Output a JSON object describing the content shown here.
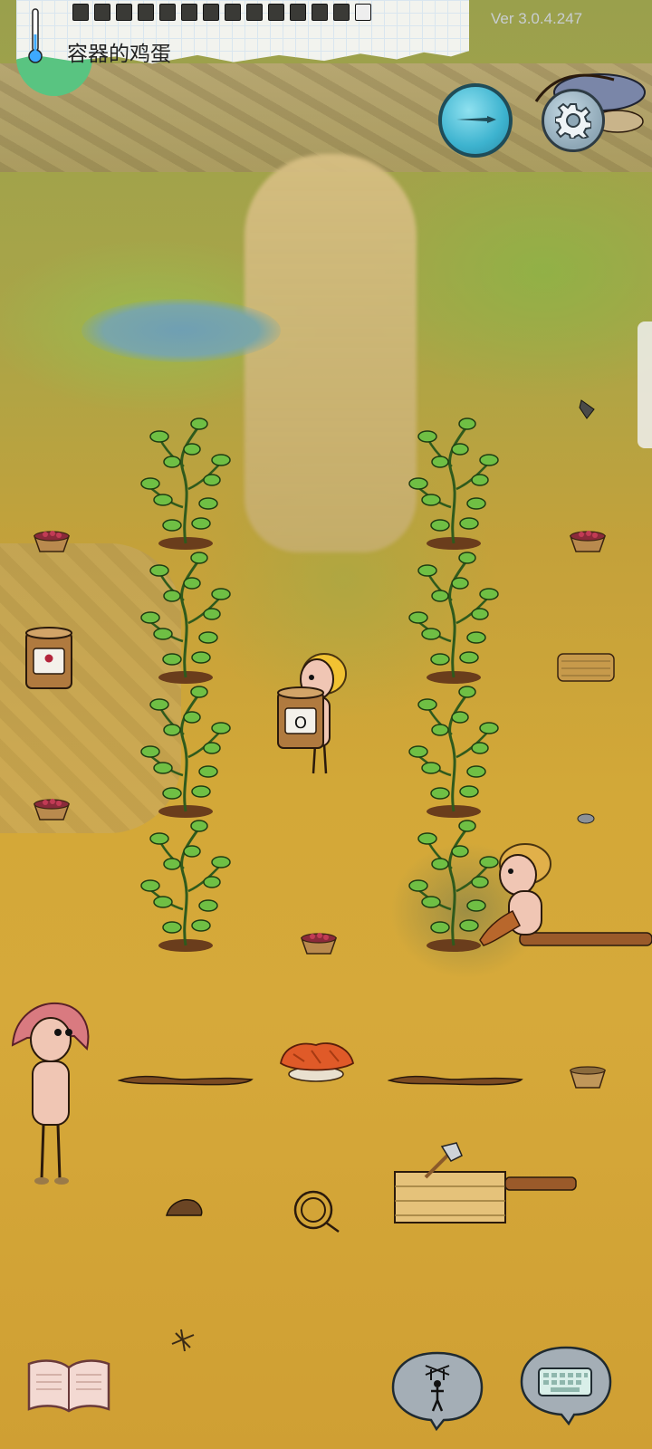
{
  "hud": {
    "hint_text": "容器的鸡蛋",
    "version": "Ver 3.0.4.247",
    "inventory_slot_count": 14
  },
  "buttons": {
    "compass": "compass-icon",
    "settings": "gear-icon",
    "tech_book": "book-icon",
    "emote": "puppet-icon",
    "chat": "keyboard-icon"
  },
  "crock_marks": {
    "left": "",
    "held": "O"
  },
  "colors": {
    "food_meter": "#59c481",
    "compass": "#3db3cf",
    "grass": "#d3a838"
  }
}
